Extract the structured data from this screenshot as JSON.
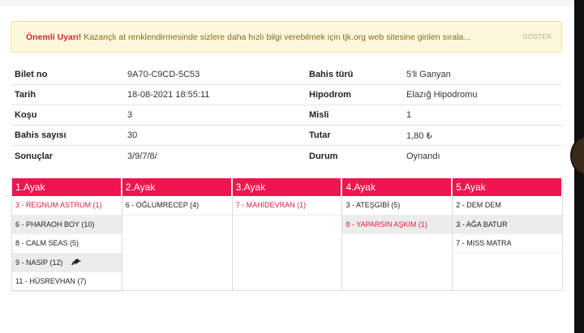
{
  "alert": {
    "strong": "Önemli Uyarı!",
    "text": " Kazançlı at renklendirmesinde sizlere daha hızlı bilgi verebilmek için tjk.org web sitesine girilen sırala...",
    "button": "GÖSTER"
  },
  "info": {
    "rows": [
      {
        "l1": "Bilet no",
        "v1": "9A70-C9CD-5C53",
        "l2": "Bahis türü",
        "v2": "5'li Ganyan"
      },
      {
        "l1": "Tarih",
        "v1": "18-08-2021 18:55:11",
        "l2": "Hipodrom",
        "v2": "Elazığ Hipodromu"
      },
      {
        "l1": "Koşu",
        "v1": "3",
        "l2": "Misli",
        "v2": "1"
      },
      {
        "l1": "Bahis sayısı",
        "v1": "30",
        "l2": "Tutar",
        "v2": "1,80 ₺"
      },
      {
        "l1": "Sonuçlar",
        "v1": "3/9/7/8/",
        "l2": "Durum",
        "v2": "Oynandı"
      }
    ]
  },
  "ayak": [
    {
      "title": "1.Ayak",
      "items": [
        "3 - REGNUM ASTRUM (1)",
        "6 - PHARAOH BOY (10)",
        "8 - CALM SEAS (5)",
        "9 - NASİP (12)",
        "11 - HÜSREVHAN (7)"
      ]
    },
    {
      "title": "2.Ayak",
      "items": [
        "6 - OĞLUMRECEP (4)"
      ]
    },
    {
      "title": "3.Ayak",
      "items": [
        "7 - MAHİDEVRAN (1)"
      ]
    },
    {
      "title": "4.Ayak",
      "items": [
        "3 - ATEŞGİBİ (5)",
        "8 - YAPARSIN AŞKIM (1)"
      ]
    },
    {
      "title": "5.Ayak",
      "items": [
        "2 - DEM DEM",
        "3 - AĞA BATUR",
        "7 - MISS MATRA"
      ]
    }
  ],
  "colors": {
    "accent": "#f0144f",
    "highlight": "#d6233e"
  },
  "icons": {
    "nasip": "horse-icon"
  }
}
